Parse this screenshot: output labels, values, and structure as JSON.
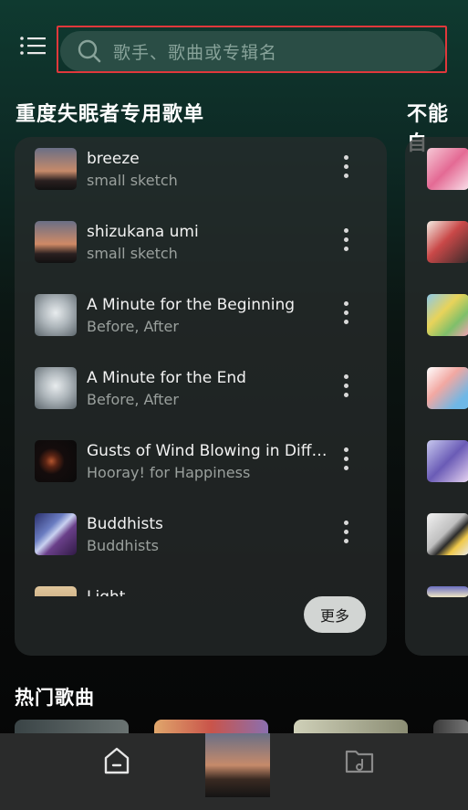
{
  "search": {
    "placeholder": "歌手、歌曲或专辑名",
    "icon": "search-icon"
  },
  "menu": {
    "icon": "menu-icon"
  },
  "playlist": {
    "title": "重度失眠者专用歌单",
    "items": [
      {
        "title": "breeze",
        "artist": "small sketch"
      },
      {
        "title": "shizukana umi",
        "artist": "small sketch"
      },
      {
        "title": "A Minute for the Beginning",
        "artist": "Before, After"
      },
      {
        "title": "A Minute for the End",
        "artist": "Before, After"
      },
      {
        "title": "Gusts of Wind Blowing in Differe…",
        "artist": "Hooray! for Happiness"
      },
      {
        "title": "Buddhists",
        "artist": "Buddhists"
      },
      {
        "title": "Light",
        "artist": ""
      }
    ],
    "more_label": "更多"
  },
  "playlist2": {
    "title": "不能自"
  },
  "hot": {
    "title": "热门歌曲"
  },
  "nav": {
    "home_icon": "home-icon",
    "folder_icon": "music-folder-icon"
  },
  "colors": {
    "accent_border": "#e0383b",
    "card_bg": "#282c2c",
    "nav_bg": "#2a2b2b"
  }
}
